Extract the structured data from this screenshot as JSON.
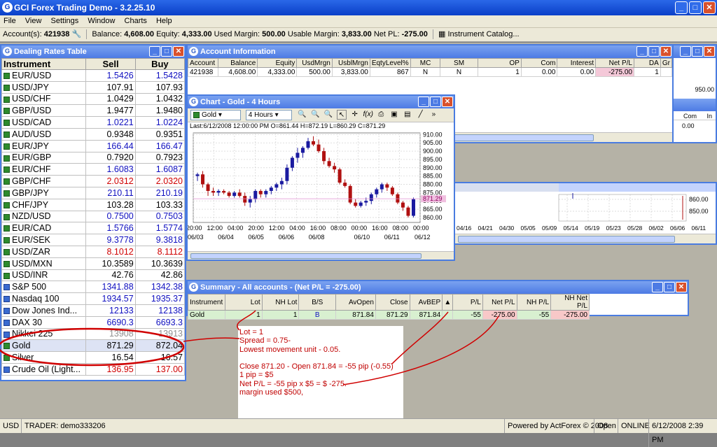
{
  "app": {
    "title": "GCI Forex Trading Demo - 3.2.25.10"
  },
  "menu": [
    "File",
    "View",
    "Settings",
    "Window",
    "Charts",
    "Help"
  ],
  "account_bar": {
    "account_label": "Account(s):",
    "account": "421938",
    "balance_label": "Balance:",
    "balance": "4,608.00",
    "equity_label": "Equity:",
    "equity": "4,333.00",
    "used_margin_label": "Used Margin:",
    "used_margin": "500.00",
    "usable_margin_label": "Usable Margin:",
    "usable_margin": "3,833.00",
    "netpl_label": "Net PL:",
    "netpl": "-275.00",
    "catalog": "Instrument Catalog..."
  },
  "dealing": {
    "title": "Dealing Rates Table",
    "headers": [
      "Instrument",
      "Sell",
      "Buy"
    ],
    "rows": [
      {
        "name": "EUR/USD",
        "sell": "1.5426",
        "buy": "1.5428",
        "c": "blue"
      },
      {
        "name": "USD/JPY",
        "sell": "107.91",
        "buy": "107.93",
        "c": "black"
      },
      {
        "name": "USD/CHF",
        "sell": "1.0429",
        "buy": "1.0432",
        "c": "black"
      },
      {
        "name": "GBP/USD",
        "sell": "1.9477",
        "buy": "1.9480",
        "c": "black"
      },
      {
        "name": "USD/CAD",
        "sell": "1.0221",
        "buy": "1.0224",
        "c": "blue"
      },
      {
        "name": "AUD/USD",
        "sell": "0.9348",
        "buy": "0.9351",
        "c": "black"
      },
      {
        "name": "EUR/JPY",
        "sell": "166.44",
        "buy": "166.47",
        "c": "blue"
      },
      {
        "name": "EUR/GBP",
        "sell": "0.7920",
        "buy": "0.7923",
        "c": "black"
      },
      {
        "name": "EUR/CHF",
        "sell": "1.6083",
        "buy": "1.6087",
        "c": "blue"
      },
      {
        "name": "GBP/CHF",
        "sell": "2.0312",
        "buy": "2.0320",
        "c": "red"
      },
      {
        "name": "GBP/JPY",
        "sell": "210.11",
        "buy": "210.19",
        "c": "blue"
      },
      {
        "name": "CHF/JPY",
        "sell": "103.28",
        "buy": "103.33",
        "c": "black"
      },
      {
        "name": "NZD/USD",
        "sell": "0.7500",
        "buy": "0.7503",
        "c": "blue"
      },
      {
        "name": "EUR/CAD",
        "sell": "1.5766",
        "buy": "1.5774",
        "c": "blue"
      },
      {
        "name": "EUR/SEK",
        "sell": "9.3778",
        "buy": "9.3818",
        "c": "blue"
      },
      {
        "name": "USD/ZAR",
        "sell": "8.1012",
        "buy": "8.1112",
        "c": "red"
      },
      {
        "name": "USD/MXN",
        "sell": "10.3589",
        "buy": "10.3639",
        "c": "black"
      },
      {
        "name": "USD/INR",
        "sell": "42.76",
        "buy": "42.86",
        "c": "black"
      },
      {
        "name": "S&P 500",
        "sell": "1341.88",
        "buy": "1342.38",
        "c": "blue",
        "icon": "blue"
      },
      {
        "name": "Nasdaq 100",
        "sell": "1934.57",
        "buy": "1935.37",
        "c": "blue",
        "icon": "blue"
      },
      {
        "name": "Dow Jones Ind...",
        "sell": "12133",
        "buy": "12138",
        "c": "blue",
        "icon": "blue"
      },
      {
        "name": "DAX 30",
        "sell": "6690.3",
        "buy": "6693.3",
        "c": "blue",
        "icon": "blue"
      },
      {
        "name": "Nikkei 225",
        "sell": "13908",
        "buy": "13913",
        "c": "grey",
        "icon": "blue"
      },
      {
        "name": "Gold",
        "sell": "871.29",
        "buy": "872.04",
        "c": "black",
        "hl": true
      },
      {
        "name": "Silver",
        "sell": "16.54",
        "buy": "16.57",
        "c": "black"
      },
      {
        "name": "Crude Oil (Light...",
        "sell": "136.95",
        "buy": "137.00",
        "c": "red",
        "icon": "blue"
      }
    ]
  },
  "account_info": {
    "title": "Account Information",
    "headers": [
      "Account",
      "Balance",
      "Equity",
      "UsdMrgn",
      "UsblMrgn",
      "EqtyLevel%",
      "MC",
      "SM",
      "OP",
      "Com",
      "Interest",
      "Net P/L",
      "DA",
      "Gr"
    ],
    "row": [
      "421938",
      "4,608.00",
      "4,333.00",
      "500.00",
      "3,833.00",
      "867",
      "N",
      "N",
      "1",
      "0.00",
      "0.00",
      "-275.00",
      "1",
      ""
    ]
  },
  "chart": {
    "title": "Chart - Gold - 4 Hours",
    "symbol": "Gold",
    "period": "4 Hours",
    "info": "Last:6/12/2008 12:00:00 PM O=861.44 H=872.19 L=860.29 C=871.29",
    "last_price": "871.29"
  },
  "chart_data": {
    "type": "candlestick",
    "y_ticks": [
      "910.00",
      "905.00",
      "900.00",
      "895.00",
      "890.00",
      "885.00",
      "880.00",
      "875.00",
      "870.00",
      "865.00",
      "860.00"
    ],
    "ylim": [
      857,
      911
    ],
    "time_ticks": [
      "20:00",
      "12:00",
      "04:00",
      "20:00",
      "12:00",
      "04:00",
      "16:00",
      "08:00",
      "00:00",
      "16:00",
      "08:00",
      "00:00"
    ],
    "date_ticks": [
      "06/03",
      "06/04",
      "06/05",
      "06/06",
      "06/08",
      "06/10",
      "06/11",
      "06/12"
    ],
    "candles": [
      [
        885,
        887,
        882,
        886
      ],
      [
        886,
        888,
        878,
        880
      ],
      [
        880,
        881,
        873,
        876
      ],
      [
        876,
        878,
        873,
        875
      ],
      [
        875,
        877,
        873,
        876
      ],
      [
        876,
        877,
        874,
        875
      ],
      [
        875,
        876,
        872,
        873
      ],
      [
        873,
        876,
        872,
        875
      ],
      [
        875,
        877,
        872,
        873
      ],
      [
        873,
        875,
        867,
        869
      ],
      [
        869,
        873,
        866,
        871
      ],
      [
        871,
        877,
        869,
        876
      ],
      [
        876,
        877,
        872,
        874
      ],
      [
        874,
        877,
        872,
        876
      ],
      [
        876,
        879,
        874,
        878
      ],
      [
        878,
        881,
        876,
        880
      ],
      [
        880,
        884,
        877,
        882
      ],
      [
        882,
        892,
        880,
        890
      ],
      [
        890,
        897,
        888,
        896
      ],
      [
        896,
        902,
        893,
        899
      ],
      [
        899,
        903,
        896,
        902
      ],
      [
        902,
        908,
        901,
        906
      ],
      [
        906,
        909,
        903,
        904
      ],
      [
        904,
        907,
        899,
        900
      ],
      [
        900,
        902,
        892,
        894
      ],
      [
        894,
        896,
        890,
        891
      ],
      [
        891,
        893,
        887,
        889
      ],
      [
        889,
        890,
        880,
        881
      ],
      [
        881,
        883,
        878,
        879
      ],
      [
        879,
        880,
        868,
        869
      ],
      [
        869,
        871,
        866,
        867
      ],
      [
        867,
        870,
        866,
        869
      ],
      [
        869,
        872,
        867,
        870
      ],
      [
        870,
        875,
        868,
        874
      ],
      [
        874,
        878,
        872,
        877
      ],
      [
        877,
        881,
        875,
        880
      ],
      [
        880,
        881,
        876,
        878
      ],
      [
        878,
        879,
        873,
        874
      ],
      [
        874,
        875,
        868,
        869
      ],
      [
        869,
        870,
        864,
        866
      ],
      [
        866,
        867,
        860,
        861
      ],
      [
        861,
        872,
        860,
        871
      ]
    ]
  },
  "background_chart": {
    "y_ticks": [
      "950.00",
      "860.00",
      "850.00"
    ],
    "dates": [
      "04/16",
      "04/21",
      "04/30",
      "05/05",
      "05/09",
      "05/14",
      "05/19",
      "05/23",
      "05/28",
      "06/02",
      "06/06",
      "06/11"
    ],
    "header_labels": [
      "Com",
      "In"
    ],
    "header_value": "0.00"
  },
  "summary": {
    "title": "Summary - All accounts - (Net P/L = -275.00)",
    "headers": [
      "Instrument",
      "Lot",
      "NH Lot",
      "B/S",
      "AvOpen",
      "Close",
      "AvBEP",
      "▲",
      "P/L",
      "Net P/L",
      "NH P/L",
      "NH Net P/L"
    ],
    "row": [
      "Gold",
      "1",
      "1",
      "B",
      "871.84",
      "871.29",
      "871.84",
      "",
      "-55",
      "-275.00",
      "-55",
      "-275.00"
    ]
  },
  "annotation": {
    "lines": [
      "Lot = 1",
      "Spread = 0.75-",
      "Lowest movement unit - 0.05.",
      "",
      "Close 871.20 - Open 871.84 = -55 pip (-0.55)",
      "1 pip = $5",
      "Net P/L = -55 pip x $5 = $ -275.",
      "margin used  $500,"
    ]
  },
  "status": {
    "currency": "USD",
    "trader": "TRADER: demo333206",
    "powered": "Powered by ActForex © 2008",
    "open": "Open",
    "online": "ONLINE",
    "datetime": "6/12/2008 2:39 PM"
  },
  "colors": {
    "title_blue": "#0a3fc8",
    "window_blue": "#4d7be4",
    "bull": "#1a1aa0",
    "bear": "#b01010",
    "annotation_red": "#c00000"
  }
}
